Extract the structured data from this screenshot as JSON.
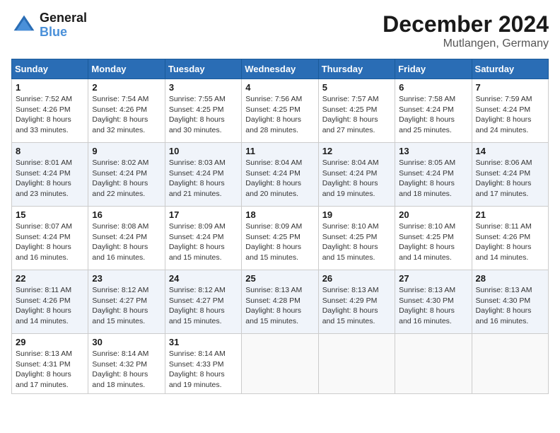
{
  "header": {
    "logo_line1": "General",
    "logo_line2": "Blue",
    "month_year": "December 2024",
    "location": "Mutlangen, Germany"
  },
  "weekdays": [
    "Sunday",
    "Monday",
    "Tuesday",
    "Wednesday",
    "Thursday",
    "Friday",
    "Saturday"
  ],
  "weeks": [
    [
      {
        "day": 1,
        "sunrise": "7:52 AM",
        "sunset": "4:26 PM",
        "daylight": "8 hours and 33 minutes."
      },
      {
        "day": 2,
        "sunrise": "7:54 AM",
        "sunset": "4:26 PM",
        "daylight": "8 hours and 32 minutes."
      },
      {
        "day": 3,
        "sunrise": "7:55 AM",
        "sunset": "4:25 PM",
        "daylight": "8 hours and 30 minutes."
      },
      {
        "day": 4,
        "sunrise": "7:56 AM",
        "sunset": "4:25 PM",
        "daylight": "8 hours and 28 minutes."
      },
      {
        "day": 5,
        "sunrise": "7:57 AM",
        "sunset": "4:25 PM",
        "daylight": "8 hours and 27 minutes."
      },
      {
        "day": 6,
        "sunrise": "7:58 AM",
        "sunset": "4:24 PM",
        "daylight": "8 hours and 25 minutes."
      },
      {
        "day": 7,
        "sunrise": "7:59 AM",
        "sunset": "4:24 PM",
        "daylight": "8 hours and 24 minutes."
      }
    ],
    [
      {
        "day": 8,
        "sunrise": "8:01 AM",
        "sunset": "4:24 PM",
        "daylight": "8 hours and 23 minutes."
      },
      {
        "day": 9,
        "sunrise": "8:02 AM",
        "sunset": "4:24 PM",
        "daylight": "8 hours and 22 minutes."
      },
      {
        "day": 10,
        "sunrise": "8:03 AM",
        "sunset": "4:24 PM",
        "daylight": "8 hours and 21 minutes."
      },
      {
        "day": 11,
        "sunrise": "8:04 AM",
        "sunset": "4:24 PM",
        "daylight": "8 hours and 20 minutes."
      },
      {
        "day": 12,
        "sunrise": "8:04 AM",
        "sunset": "4:24 PM",
        "daylight": "8 hours and 19 minutes."
      },
      {
        "day": 13,
        "sunrise": "8:05 AM",
        "sunset": "4:24 PM",
        "daylight": "8 hours and 18 minutes."
      },
      {
        "day": 14,
        "sunrise": "8:06 AM",
        "sunset": "4:24 PM",
        "daylight": "8 hours and 17 minutes."
      }
    ],
    [
      {
        "day": 15,
        "sunrise": "8:07 AM",
        "sunset": "4:24 PM",
        "daylight": "8 hours and 16 minutes."
      },
      {
        "day": 16,
        "sunrise": "8:08 AM",
        "sunset": "4:24 PM",
        "daylight": "8 hours and 16 minutes."
      },
      {
        "day": 17,
        "sunrise": "8:09 AM",
        "sunset": "4:24 PM",
        "daylight": "8 hours and 15 minutes."
      },
      {
        "day": 18,
        "sunrise": "8:09 AM",
        "sunset": "4:25 PM",
        "daylight": "8 hours and 15 minutes."
      },
      {
        "day": 19,
        "sunrise": "8:10 AM",
        "sunset": "4:25 PM",
        "daylight": "8 hours and 15 minutes."
      },
      {
        "day": 20,
        "sunrise": "8:10 AM",
        "sunset": "4:25 PM",
        "daylight": "8 hours and 14 minutes."
      },
      {
        "day": 21,
        "sunrise": "8:11 AM",
        "sunset": "4:26 PM",
        "daylight": "8 hours and 14 minutes."
      }
    ],
    [
      {
        "day": 22,
        "sunrise": "8:11 AM",
        "sunset": "4:26 PM",
        "daylight": "8 hours and 14 minutes."
      },
      {
        "day": 23,
        "sunrise": "8:12 AM",
        "sunset": "4:27 PM",
        "daylight": "8 hours and 15 minutes."
      },
      {
        "day": 24,
        "sunrise": "8:12 AM",
        "sunset": "4:27 PM",
        "daylight": "8 hours and 15 minutes."
      },
      {
        "day": 25,
        "sunrise": "8:13 AM",
        "sunset": "4:28 PM",
        "daylight": "8 hours and 15 minutes."
      },
      {
        "day": 26,
        "sunrise": "8:13 AM",
        "sunset": "4:29 PM",
        "daylight": "8 hours and 15 minutes."
      },
      {
        "day": 27,
        "sunrise": "8:13 AM",
        "sunset": "4:30 PM",
        "daylight": "8 hours and 16 minutes."
      },
      {
        "day": 28,
        "sunrise": "8:13 AM",
        "sunset": "4:30 PM",
        "daylight": "8 hours and 16 minutes."
      }
    ],
    [
      {
        "day": 29,
        "sunrise": "8:13 AM",
        "sunset": "4:31 PM",
        "daylight": "8 hours and 17 minutes."
      },
      {
        "day": 30,
        "sunrise": "8:14 AM",
        "sunset": "4:32 PM",
        "daylight": "8 hours and 18 minutes."
      },
      {
        "day": 31,
        "sunrise": "8:14 AM",
        "sunset": "4:33 PM",
        "daylight": "8 hours and 19 minutes."
      },
      null,
      null,
      null,
      null
    ]
  ]
}
